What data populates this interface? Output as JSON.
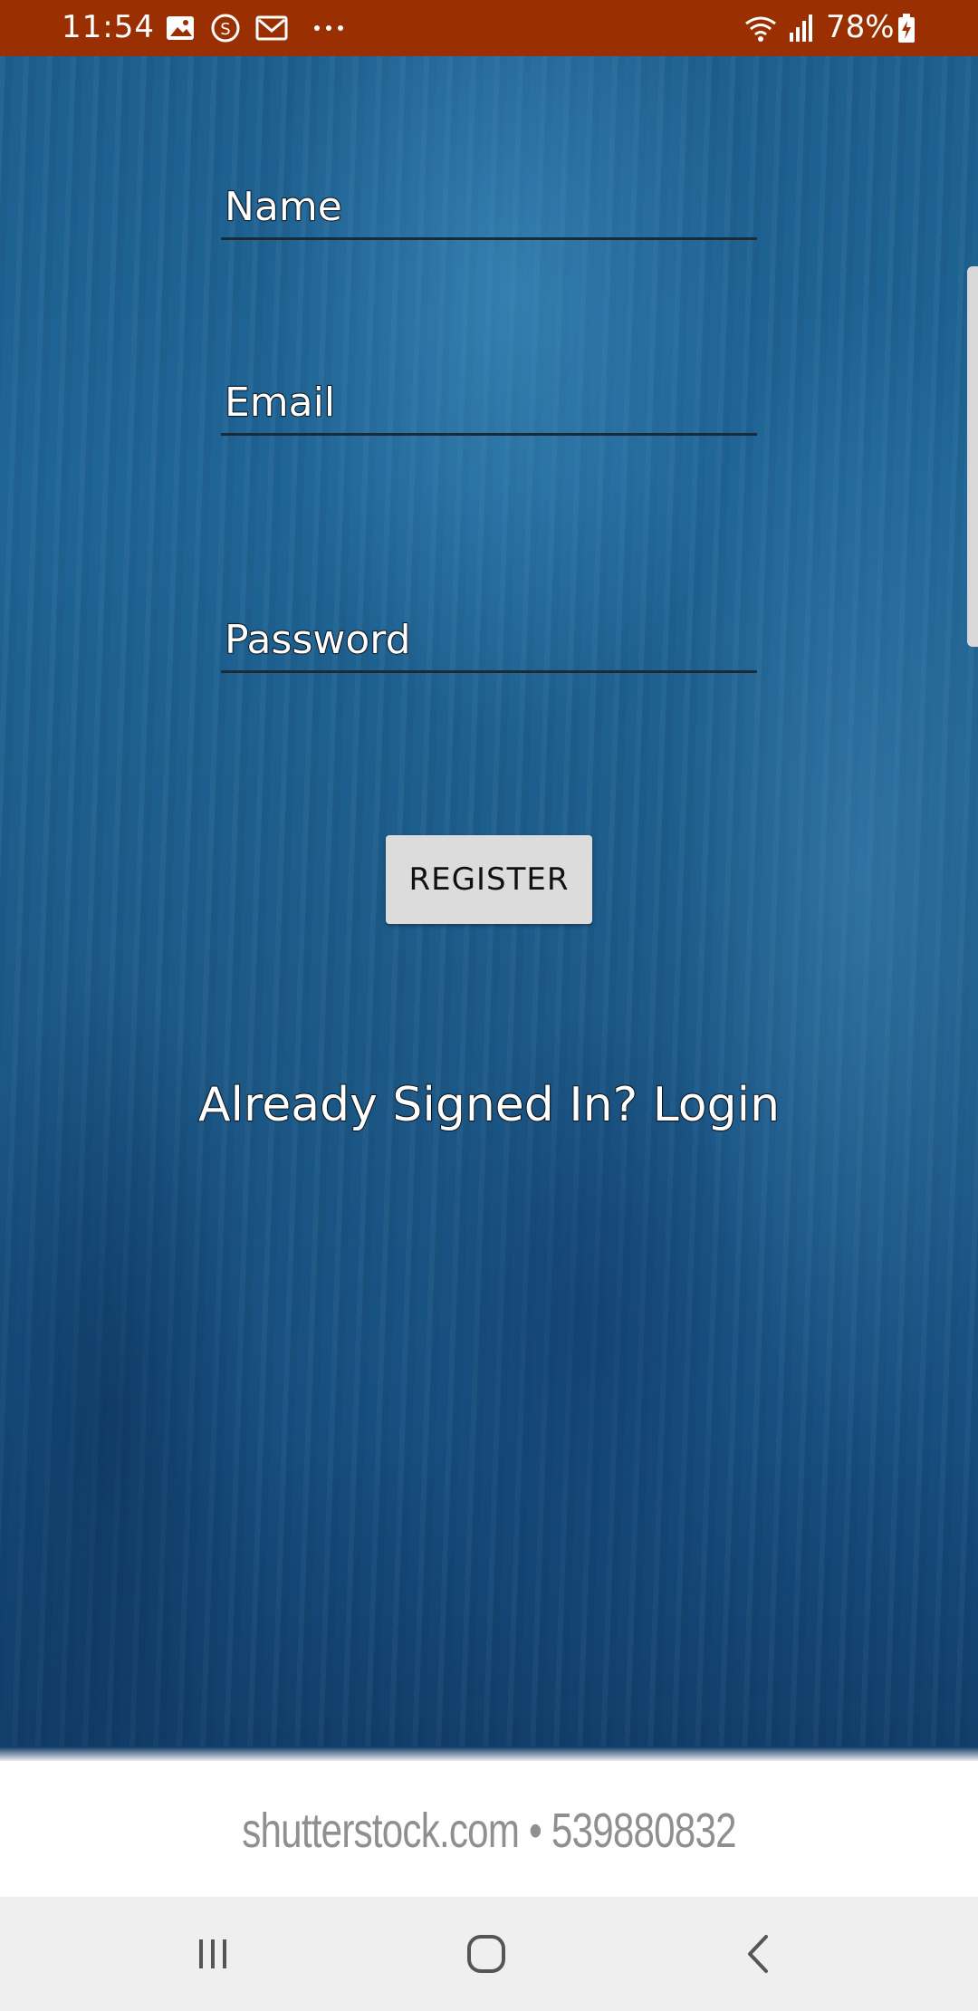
{
  "status_bar": {
    "time": "11:54",
    "battery": "78%",
    "icons": [
      "gallery-icon",
      "s-circle-icon",
      "gmail-icon",
      "more-dots-icon",
      "wifi-icon",
      "signal-icon",
      "battery-charging-icon"
    ]
  },
  "form": {
    "name_placeholder": "Name",
    "email_placeholder": "Email",
    "password_placeholder": "Password",
    "register_label": "REGISTER",
    "login_link": "Already Signed In? Login"
  },
  "watermark": {
    "text": "shutterstock.com • 539880832"
  },
  "nav": {
    "icons": [
      "recent-apps-icon",
      "home-icon",
      "back-icon"
    ]
  },
  "colors": {
    "status_bar": "#9a2f02",
    "background": "#1e5f8f",
    "button": "#dcdcdc"
  }
}
